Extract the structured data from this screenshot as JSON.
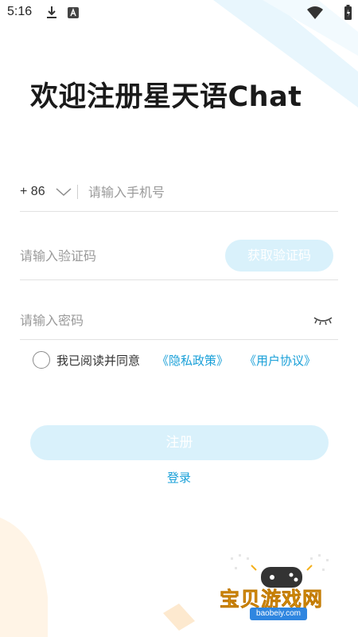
{
  "status_bar": {
    "time": "5:16",
    "icons": [
      "download-icon",
      "app-notification-icon",
      "wifi-icon",
      "battery-icon"
    ]
  },
  "title": "欢迎注册星天语Chat",
  "phone": {
    "country_code": "+ 86",
    "placeholder": "请输入手机号",
    "value": ""
  },
  "verification": {
    "placeholder": "请输入验证码",
    "value": "",
    "button_label": "获取验证码"
  },
  "password": {
    "placeholder": "请输入密码",
    "value": ""
  },
  "agreement": {
    "text": "我已阅读并同意",
    "privacy_link": "《隐私政策》",
    "user_link": "《用户协议》",
    "checked": false
  },
  "register_button": "注册",
  "login_link": "登录",
  "watermark": {
    "text": "宝贝游戏网",
    "url": "baobeiy.com"
  },
  "colors": {
    "accent": "#1aa0d8",
    "button_disabled_bg": "#d9f1fb",
    "watermark": "#f5b01b"
  }
}
